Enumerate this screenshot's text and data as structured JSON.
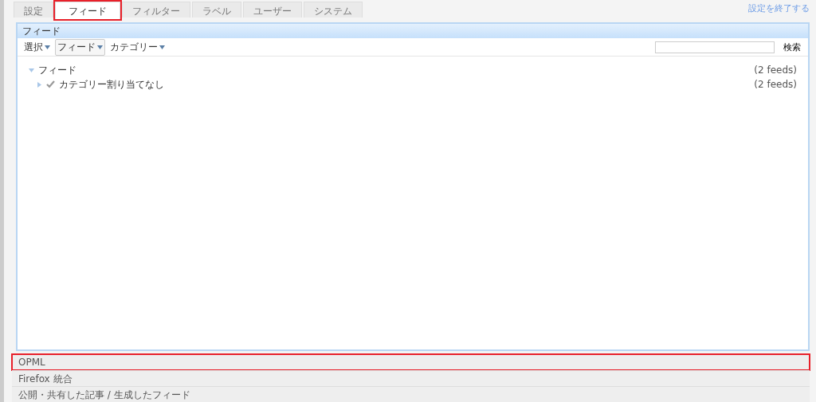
{
  "tabs": [
    {
      "label": "設定",
      "selected": false,
      "highlighted": false
    },
    {
      "label": "フィード",
      "selected": true,
      "highlighted": true
    },
    {
      "label": "フィルター",
      "selected": false,
      "highlighted": false
    },
    {
      "label": "ラベル",
      "selected": false,
      "highlighted": false
    },
    {
      "label": "ユーザー",
      "selected": false,
      "highlighted": false
    },
    {
      "label": "システム",
      "selected": false,
      "highlighted": false
    }
  ],
  "exit_link": "設定を終了する",
  "panel": {
    "title": "フィード",
    "toolbar": [
      {
        "label": "選択",
        "kind": "plain"
      },
      {
        "label": "フィード",
        "kind": "boxed"
      },
      {
        "label": "カテゴリー",
        "kind": "plain"
      }
    ],
    "search": {
      "button": "検索"
    },
    "tree": [
      {
        "label": "フィード",
        "count": "(2 feeds)",
        "expanded": true,
        "children": [
          {
            "label": "カテゴリー割り当てなし",
            "count": "(2 feeds)",
            "expanded": false
          }
        ]
      }
    ]
  },
  "sections": [
    {
      "title": "OPML",
      "highlighted": true
    },
    {
      "title": "Firefox 統合",
      "highlighted": false
    },
    {
      "title": "公開・共有した記事 / 生成したフィード",
      "highlighted": false
    }
  ]
}
